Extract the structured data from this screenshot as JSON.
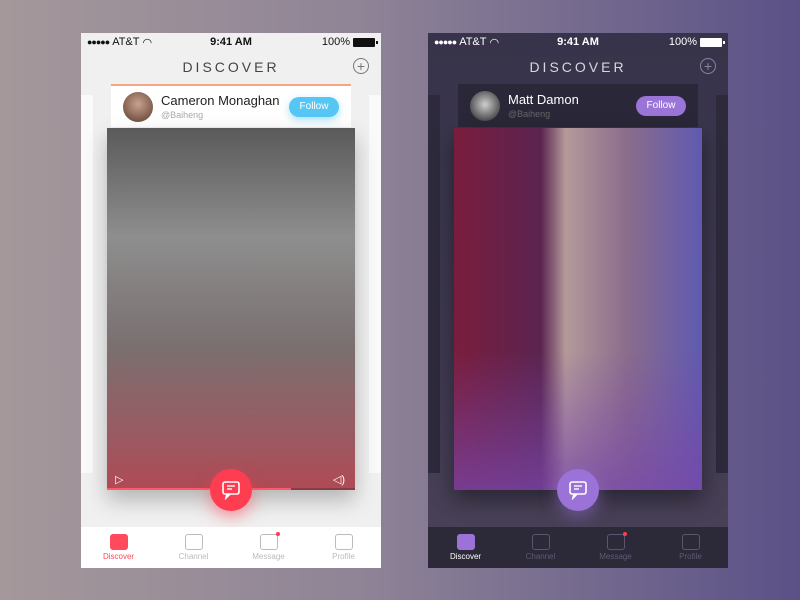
{
  "screens": [
    {
      "theme": "light",
      "status": {
        "carrier": "AT&T",
        "time": "9:41 AM",
        "battery": "100%"
      },
      "title": "DISCOVER",
      "add_icon": "plus-circle-icon",
      "card": {
        "name": "Cameron Monaghan",
        "handle": "@Baiheng",
        "follow_label": "Follow"
      },
      "video": {
        "progress": 0.74
      },
      "fab_icon": "comment-icon",
      "tabs": [
        {
          "label": "Discover",
          "icon": "discover-icon",
          "active": true
        },
        {
          "label": "Channel",
          "icon": "channel-icon",
          "active": false
        },
        {
          "label": "Message",
          "icon": "message-icon",
          "active": false,
          "badge": true
        },
        {
          "label": "Profile",
          "icon": "profile-icon",
          "active": false
        }
      ],
      "colors": {
        "accent": "#ff3d51",
        "follow": "#56c6f5"
      }
    },
    {
      "theme": "dark",
      "status": {
        "carrier": "AT&T",
        "time": "9:41 AM",
        "battery": "100%"
      },
      "title": "DISCOVER",
      "add_icon": "plus-circle-icon",
      "card": {
        "name": "Matt Damon",
        "handle": "@Baiheng",
        "follow_label": "Follow"
      },
      "fab_icon": "comment-icon",
      "tabs": [
        {
          "label": "Discover",
          "icon": "discover-icon",
          "active": true
        },
        {
          "label": "Channel",
          "icon": "channel-icon",
          "active": false
        },
        {
          "label": "Message",
          "icon": "message-icon",
          "active": false,
          "badge": true
        },
        {
          "label": "Profile",
          "icon": "profile-icon",
          "active": false
        }
      ],
      "colors": {
        "accent": "#9a72d8",
        "follow": "#9a74d6"
      }
    }
  ]
}
